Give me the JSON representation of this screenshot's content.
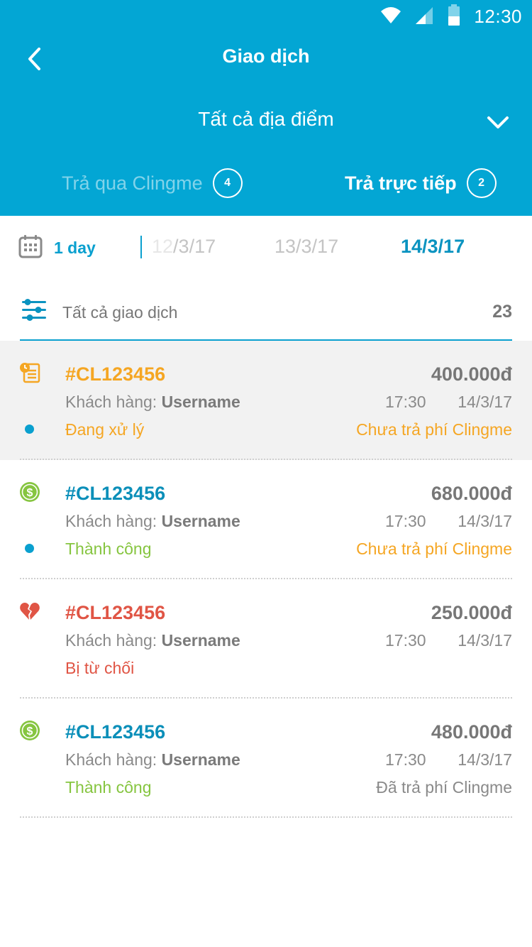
{
  "status_bar": {
    "time": "12:30"
  },
  "header": {
    "title": "Giao dịch",
    "location": "Tất cả địa điểm",
    "tabs": [
      {
        "label": "Trả qua Clingme",
        "count": "4",
        "active": false
      },
      {
        "label": "Trả trực tiếp",
        "count": "2",
        "active": true
      }
    ]
  },
  "date_filter": {
    "period": "1 day",
    "dates": [
      {
        "faded_part": "12",
        "rest": "/3/17",
        "active": false
      },
      {
        "label": "13/3/17",
        "active": false
      },
      {
        "label": "14/3/17",
        "active": true
      }
    ]
  },
  "filter": {
    "label": "Tất cả giao dịch",
    "count": "23"
  },
  "transactions": [
    {
      "icon": "pending-document-icon",
      "id": "#CL123456",
      "amount": "400.000đ",
      "customer_label": "Khách hàng: ",
      "customer_name": "Username",
      "time": "17:30",
      "date": "14/3/17",
      "status": "Đang xử lý",
      "fee_status": "Chưa trả phí Clingme",
      "unread": true,
      "highlight": true
    },
    {
      "icon": "dollar-coin-icon",
      "id": "#CL123456",
      "amount": "680.000đ",
      "customer_label": "Khách hàng: ",
      "customer_name": "Username",
      "time": "17:30",
      "date": "14/3/17",
      "status": "Thành công",
      "fee_status": "Chưa trả phí Clingme",
      "unread": true,
      "highlight": false
    },
    {
      "icon": "broken-heart-icon",
      "id": "#CL123456",
      "amount": "250.000đ",
      "customer_label": "Khách hàng: ",
      "customer_name": "Username",
      "time": "17:30",
      "date": "14/3/17",
      "status": "Bị từ chối",
      "fee_status": "",
      "unread": false,
      "highlight": false
    },
    {
      "icon": "dollar-coin-icon",
      "id": "#CL123456",
      "amount": "480.000đ",
      "customer_label": "Khách hàng: ",
      "customer_name": "Username",
      "time": "17:30",
      "date": "14/3/17",
      "status": "Thành công",
      "fee_status": "Đã trả phí Clingme",
      "unread": false,
      "highlight": false
    }
  ],
  "colors": {
    "header_bg": "#03a6d4",
    "accent": "#0aa0cf",
    "pending": "#f5a623",
    "success": "#86c540",
    "rejected": "#e05545",
    "id_blue": "#0b8fb9"
  }
}
